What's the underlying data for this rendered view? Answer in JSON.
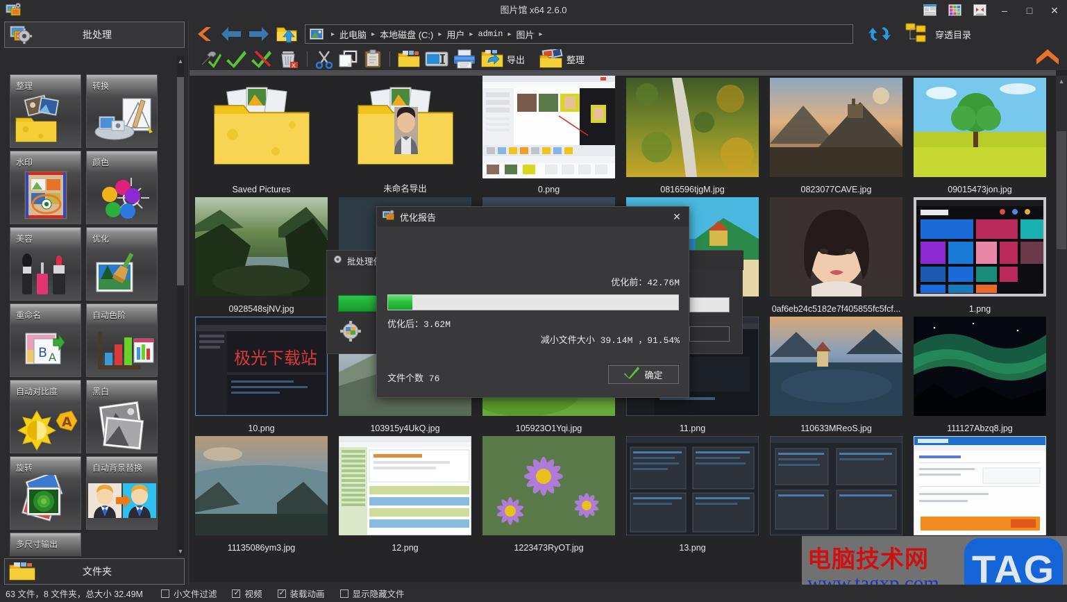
{
  "window": {
    "title": "图片馆 x64 2.6.0",
    "logo_icon": "app-photo-icon",
    "buttons": [
      {
        "name": "list-view-icon",
        "glyph": "▤"
      },
      {
        "name": "tile-view-icon",
        "glyph": "▦"
      },
      {
        "name": "fullscreen-view-icon",
        "glyph": "▣"
      },
      {
        "name": "minimize-icon",
        "glyph": "–"
      },
      {
        "name": "maximize-icon",
        "glyph": "□"
      },
      {
        "name": "close-icon",
        "glyph": "✕"
      }
    ]
  },
  "sidebar": {
    "header": {
      "label": "批处理",
      "icon": "gear-photos-icon"
    },
    "tiles": [
      {
        "label": "整理",
        "icon": "folder-photos-icon"
      },
      {
        "label": "转换",
        "icon": "convert-tools-icon"
      },
      {
        "label": "水印",
        "icon": "watermark-stamp-icon"
      },
      {
        "label": "颜色",
        "icon": "color-wheel-icon"
      },
      {
        "label": "美容",
        "icon": "cosmetics-icon"
      },
      {
        "label": "优化",
        "icon": "optimize-broom-icon"
      },
      {
        "label": "重命名",
        "icon": "rename-icon"
      },
      {
        "label": "自动色阶",
        "icon": "auto-levels-chart-icon"
      },
      {
        "label": "自动对比度",
        "icon": "auto-contrast-sun-icon"
      },
      {
        "label": "黑白",
        "icon": "black-white-photo-icon"
      },
      {
        "label": "旋转",
        "icon": "rotate-photo-icon"
      },
      {
        "label": "自动背景替换",
        "icon": "background-replace-icon"
      },
      {
        "label": "多尺寸输出",
        "icon": "multi-size-output-icon"
      }
    ],
    "footer": {
      "label": "文件夹",
      "icon": "folder-icon"
    }
  },
  "toolbar": {
    "nav": [
      {
        "name": "back-chevron-icon",
        "glyph": "❮"
      },
      {
        "name": "back-arrow-icon",
        "glyph": "⬅"
      },
      {
        "name": "forward-arrow-icon",
        "glyph": "➡"
      },
      {
        "name": "up-folder-icon",
        "glyph": "📂"
      }
    ],
    "path": {
      "icon": "picture-folder-icon",
      "crumbs": [
        "此电脑",
        "本地磁盘 (C:)",
        "用户",
        "admin",
        "图片"
      ],
      "separator": "▸"
    },
    "refresh_icon": "refresh-icon",
    "deep_dir": {
      "label": "穿透目录",
      "icon": "tree-folders-icon"
    },
    "tools": [
      {
        "name": "settings-check-icon",
        "label": ""
      },
      {
        "name": "select-all-icon",
        "label": ""
      },
      {
        "name": "deselect-all-icon",
        "label": ""
      },
      {
        "name": "delete-icon",
        "label": ""
      },
      {
        "name": "cut-icon",
        "label": ""
      },
      {
        "name": "copy-icon",
        "label": ""
      },
      {
        "name": "paste-icon",
        "label": ""
      },
      {
        "name": "new-folder-icon",
        "label": ""
      },
      {
        "name": "rename-icon",
        "label": ""
      },
      {
        "name": "print-icon",
        "label": ""
      },
      {
        "name": "export-icon",
        "label": "导出"
      },
      {
        "name": "organize-icon",
        "label": "整理"
      }
    ],
    "collapse_icon": "collapse-up-icon"
  },
  "grid": {
    "items": [
      {
        "name": "Saved Pictures",
        "kind": "folder"
      },
      {
        "name": "未命名导出",
        "kind": "folder-portrait"
      },
      {
        "name": "0.png",
        "kind": "screenshot-editor"
      },
      {
        "name": "0816596tjgM.jpg",
        "kind": "photo-aerial-road"
      },
      {
        "name": "0823077CAVE.jpg",
        "kind": "photo-castle-hill"
      },
      {
        "name": "09015473jon.jpg",
        "kind": "photo-tree-field"
      },
      {
        "name": "0928548sjNV.jpg",
        "kind": "photo-forest-lake"
      },
      {
        "name": "",
        "kind": "hidden-behind-dialog"
      },
      {
        "name": "",
        "kind": "hidden-behind-dialog"
      },
      {
        "name": "",
        "kind": "photo-beach-island"
      },
      {
        "name": "0af6eb24c5182e7f405855fc5fcf...",
        "kind": "photo-portrait-girl"
      },
      {
        "name": "1.png",
        "kind": "screenshot-tiles"
      },
      {
        "name": "10.png",
        "kind": "screenshot-code"
      },
      {
        "name": "103915y4UkQ.jpg",
        "kind": "photo-hills-sky"
      },
      {
        "name": "105923O1Yqi.jpg",
        "kind": "photo-green-field"
      },
      {
        "name": "11.png",
        "kind": "screenshot-dark-app"
      },
      {
        "name": "110633MReoS.jpg",
        "kind": "photo-lake-mountains"
      },
      {
        "name": "111127Abzq8.jpg",
        "kind": "photo-aurora-night"
      },
      {
        "name": "11135086ym3.jpg",
        "kind": "photo-sea-rocks"
      },
      {
        "name": "12.png",
        "kind": "screenshot-spreadsheet"
      },
      {
        "name": "1223473RyOT.jpg",
        "kind": "photo-purple-flowers"
      },
      {
        "name": "13.png",
        "kind": "screenshot-dialogs"
      },
      {
        "name": "",
        "kind": "screenshot-form"
      },
      {
        "name": "",
        "kind": "screenshot-pdf-tool"
      }
    ]
  },
  "background_dialog": {
    "title": "批处理任务",
    "icon": "gear-icon"
  },
  "modal": {
    "title": "优化报告",
    "icon": "app-photo-icon",
    "close_glyph": "✕",
    "before_label": "优化前：42.76M",
    "progress_percent": 8.46,
    "after_label": "优化后：3.62M",
    "reduce_label": "减小文件大小 39.14M ，91.54%",
    "count_label": "文件个数 76",
    "ok_label": "确定",
    "ok_icon": "check-icon"
  },
  "status_bar": {
    "summary": "63 文件，8 文件夹，总大小 32.49M",
    "checkboxes": [
      {
        "label": "小文件过滤",
        "checked": false
      },
      {
        "label": "视频",
        "checked": true
      },
      {
        "label": "装载动画",
        "checked": true
      },
      {
        "label": "显示隐藏文件",
        "checked": false
      }
    ]
  },
  "watermark": {
    "chinese": "电脑技术网",
    "url": "www.tagxp.com",
    "tag": "TAG"
  },
  "colors": {
    "window_bg": "#2b2b2e",
    "panel_bg": "#2d2d30",
    "grid_bg": "#252528",
    "accent_green": "#2ec23f",
    "accent_orange": "#e8702a",
    "accent_blue": "#2f7fbf",
    "watermark_red": "#d01010",
    "watermark_blue": "#1335c4"
  }
}
